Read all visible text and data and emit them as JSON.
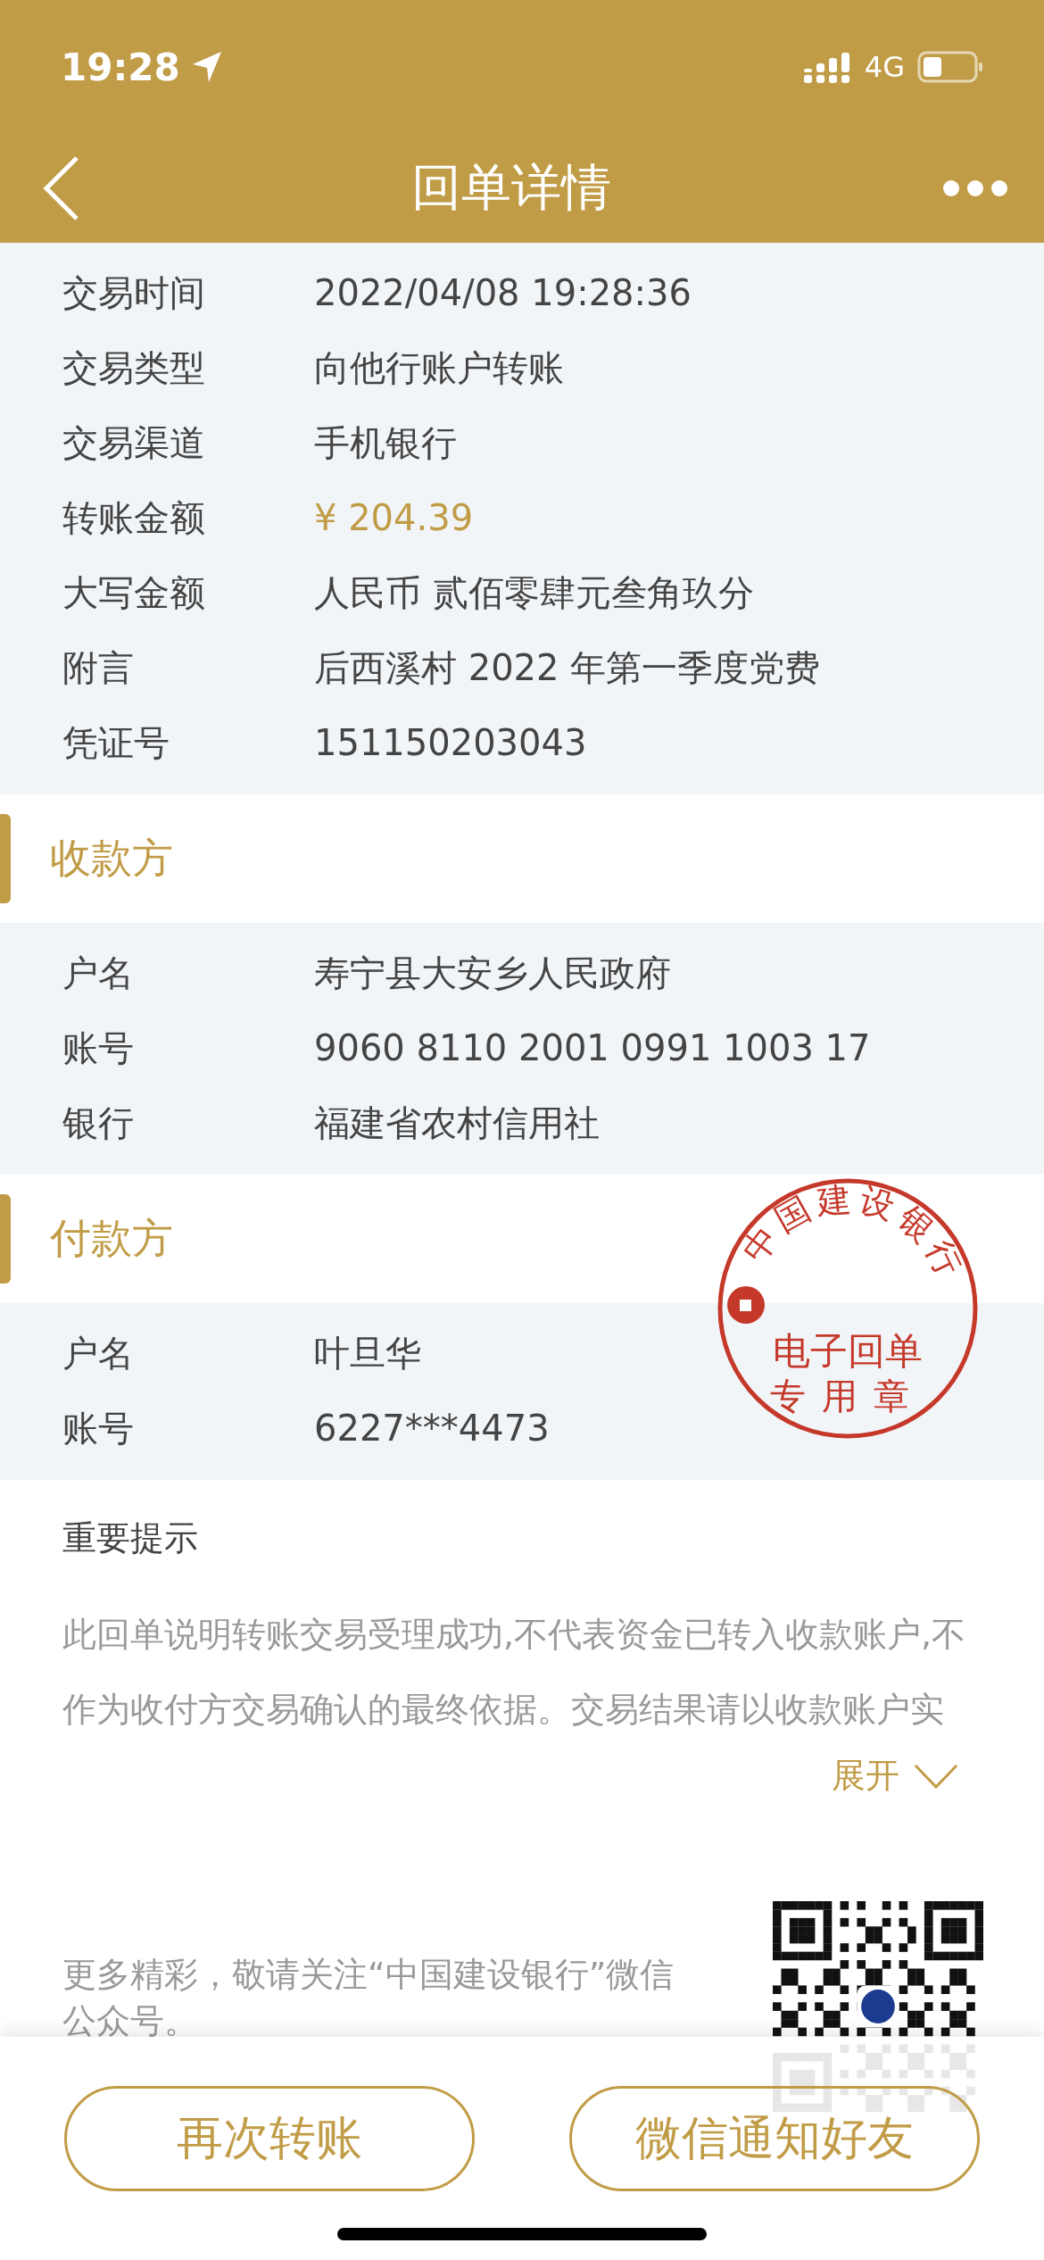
{
  "status_bar": {
    "time": "19:28",
    "network": "4G"
  },
  "nav": {
    "title": "回单详情"
  },
  "details": [
    {
      "label": "交易时间",
      "value": "2022/04/08 19:28:36",
      "kind": "plain"
    },
    {
      "label": "交易类型",
      "value": "向他行账户转账",
      "kind": "plain"
    },
    {
      "label": "交易渠道",
      "value": "手机银行",
      "kind": "plain"
    },
    {
      "label": "转账金额",
      "value": "¥ 204.39",
      "kind": "amount"
    },
    {
      "label": "大写金额",
      "value": "人民币 贰佰零肆元叁角玖分",
      "kind": "plain"
    },
    {
      "label": "附言",
      "value": "后西溪村 2022 年第一季度党费",
      "kind": "plain"
    },
    {
      "label": "凭证号",
      "value": "151150203043",
      "kind": "plain"
    }
  ],
  "sections": [
    {
      "title": "收款方",
      "rows": [
        {
          "label": "户名",
          "value": "寿宁县大安乡人民政府"
        },
        {
          "label": "账号",
          "value": "9060 8110 2001 0991 1003 17"
        },
        {
          "label": "银行",
          "value": "福建省农村信用社"
        }
      ]
    },
    {
      "title": "付款方",
      "rows": [
        {
          "label": "户名",
          "value": "叶旦华"
        },
        {
          "label": "账号",
          "value": "6227***4473"
        }
      ]
    }
  ],
  "stamp": {
    "arc_text": "中国建设银行",
    "line_1": "电子回单",
    "line_2": "专用章"
  },
  "notice": {
    "title": "重要提示",
    "text": "此回单说明转账交易受理成功,不代表资金已转入收款账户,不作为收付方交易确认的最终依据。交易结果请以收款账户实",
    "expand": "展开"
  },
  "promo": {
    "text": "更多精彩，敬请关注“中国建设银行”微信公众号。"
  },
  "buttons": [
    "再次转账",
    "微信通知好友"
  ]
}
